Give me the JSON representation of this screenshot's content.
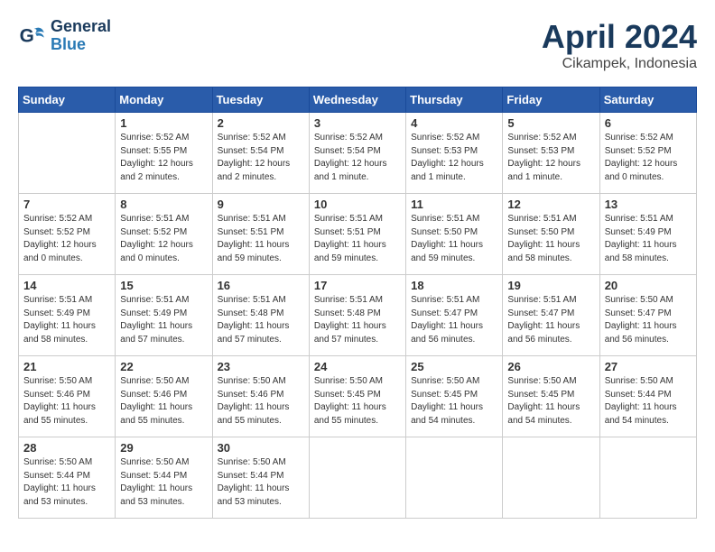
{
  "header": {
    "logo_general": "General",
    "logo_blue": "Blue",
    "month_title": "April 2024",
    "location": "Cikampek, Indonesia"
  },
  "weekdays": [
    "Sunday",
    "Monday",
    "Tuesday",
    "Wednesday",
    "Thursday",
    "Friday",
    "Saturday"
  ],
  "weeks": [
    [
      {
        "day": "",
        "sunrise": "",
        "sunset": "",
        "daylight": ""
      },
      {
        "day": "1",
        "sunrise": "Sunrise: 5:52 AM",
        "sunset": "Sunset: 5:55 PM",
        "daylight": "Daylight: 12 hours and 2 minutes."
      },
      {
        "day": "2",
        "sunrise": "Sunrise: 5:52 AM",
        "sunset": "Sunset: 5:54 PM",
        "daylight": "Daylight: 12 hours and 2 minutes."
      },
      {
        "day": "3",
        "sunrise": "Sunrise: 5:52 AM",
        "sunset": "Sunset: 5:54 PM",
        "daylight": "Daylight: 12 hours and 1 minute."
      },
      {
        "day": "4",
        "sunrise": "Sunrise: 5:52 AM",
        "sunset": "Sunset: 5:53 PM",
        "daylight": "Daylight: 12 hours and 1 minute."
      },
      {
        "day": "5",
        "sunrise": "Sunrise: 5:52 AM",
        "sunset": "Sunset: 5:53 PM",
        "daylight": "Daylight: 12 hours and 1 minute."
      },
      {
        "day": "6",
        "sunrise": "Sunrise: 5:52 AM",
        "sunset": "Sunset: 5:52 PM",
        "daylight": "Daylight: 12 hours and 0 minutes."
      }
    ],
    [
      {
        "day": "7",
        "sunrise": "Sunrise: 5:52 AM",
        "sunset": "Sunset: 5:52 PM",
        "daylight": "Daylight: 12 hours and 0 minutes."
      },
      {
        "day": "8",
        "sunrise": "Sunrise: 5:51 AM",
        "sunset": "Sunset: 5:52 PM",
        "daylight": "Daylight: 12 hours and 0 minutes."
      },
      {
        "day": "9",
        "sunrise": "Sunrise: 5:51 AM",
        "sunset": "Sunset: 5:51 PM",
        "daylight": "Daylight: 11 hours and 59 minutes."
      },
      {
        "day": "10",
        "sunrise": "Sunrise: 5:51 AM",
        "sunset": "Sunset: 5:51 PM",
        "daylight": "Daylight: 11 hours and 59 minutes."
      },
      {
        "day": "11",
        "sunrise": "Sunrise: 5:51 AM",
        "sunset": "Sunset: 5:50 PM",
        "daylight": "Daylight: 11 hours and 59 minutes."
      },
      {
        "day": "12",
        "sunrise": "Sunrise: 5:51 AM",
        "sunset": "Sunset: 5:50 PM",
        "daylight": "Daylight: 11 hours and 58 minutes."
      },
      {
        "day": "13",
        "sunrise": "Sunrise: 5:51 AM",
        "sunset": "Sunset: 5:49 PM",
        "daylight": "Daylight: 11 hours and 58 minutes."
      }
    ],
    [
      {
        "day": "14",
        "sunrise": "Sunrise: 5:51 AM",
        "sunset": "Sunset: 5:49 PM",
        "daylight": "Daylight: 11 hours and 58 minutes."
      },
      {
        "day": "15",
        "sunrise": "Sunrise: 5:51 AM",
        "sunset": "Sunset: 5:49 PM",
        "daylight": "Daylight: 11 hours and 57 minutes."
      },
      {
        "day": "16",
        "sunrise": "Sunrise: 5:51 AM",
        "sunset": "Sunset: 5:48 PM",
        "daylight": "Daylight: 11 hours and 57 minutes."
      },
      {
        "day": "17",
        "sunrise": "Sunrise: 5:51 AM",
        "sunset": "Sunset: 5:48 PM",
        "daylight": "Daylight: 11 hours and 57 minutes."
      },
      {
        "day": "18",
        "sunrise": "Sunrise: 5:51 AM",
        "sunset": "Sunset: 5:47 PM",
        "daylight": "Daylight: 11 hours and 56 minutes."
      },
      {
        "day": "19",
        "sunrise": "Sunrise: 5:51 AM",
        "sunset": "Sunset: 5:47 PM",
        "daylight": "Daylight: 11 hours and 56 minutes."
      },
      {
        "day": "20",
        "sunrise": "Sunrise: 5:50 AM",
        "sunset": "Sunset: 5:47 PM",
        "daylight": "Daylight: 11 hours and 56 minutes."
      }
    ],
    [
      {
        "day": "21",
        "sunrise": "Sunrise: 5:50 AM",
        "sunset": "Sunset: 5:46 PM",
        "daylight": "Daylight: 11 hours and 55 minutes."
      },
      {
        "day": "22",
        "sunrise": "Sunrise: 5:50 AM",
        "sunset": "Sunset: 5:46 PM",
        "daylight": "Daylight: 11 hours and 55 minutes."
      },
      {
        "day": "23",
        "sunrise": "Sunrise: 5:50 AM",
        "sunset": "Sunset: 5:46 PM",
        "daylight": "Daylight: 11 hours and 55 minutes."
      },
      {
        "day": "24",
        "sunrise": "Sunrise: 5:50 AM",
        "sunset": "Sunset: 5:45 PM",
        "daylight": "Daylight: 11 hours and 55 minutes."
      },
      {
        "day": "25",
        "sunrise": "Sunrise: 5:50 AM",
        "sunset": "Sunset: 5:45 PM",
        "daylight": "Daylight: 11 hours and 54 minutes."
      },
      {
        "day": "26",
        "sunrise": "Sunrise: 5:50 AM",
        "sunset": "Sunset: 5:45 PM",
        "daylight": "Daylight: 11 hours and 54 minutes."
      },
      {
        "day": "27",
        "sunrise": "Sunrise: 5:50 AM",
        "sunset": "Sunset: 5:44 PM",
        "daylight": "Daylight: 11 hours and 54 minutes."
      }
    ],
    [
      {
        "day": "28",
        "sunrise": "Sunrise: 5:50 AM",
        "sunset": "Sunset: 5:44 PM",
        "daylight": "Daylight: 11 hours and 53 minutes."
      },
      {
        "day": "29",
        "sunrise": "Sunrise: 5:50 AM",
        "sunset": "Sunset: 5:44 PM",
        "daylight": "Daylight: 11 hours and 53 minutes."
      },
      {
        "day": "30",
        "sunrise": "Sunrise: 5:50 AM",
        "sunset": "Sunset: 5:44 PM",
        "daylight": "Daylight: 11 hours and 53 minutes."
      },
      {
        "day": "",
        "sunrise": "",
        "sunset": "",
        "daylight": ""
      },
      {
        "day": "",
        "sunrise": "",
        "sunset": "",
        "daylight": ""
      },
      {
        "day": "",
        "sunrise": "",
        "sunset": "",
        "daylight": ""
      },
      {
        "day": "",
        "sunrise": "",
        "sunset": "",
        "daylight": ""
      }
    ]
  ]
}
